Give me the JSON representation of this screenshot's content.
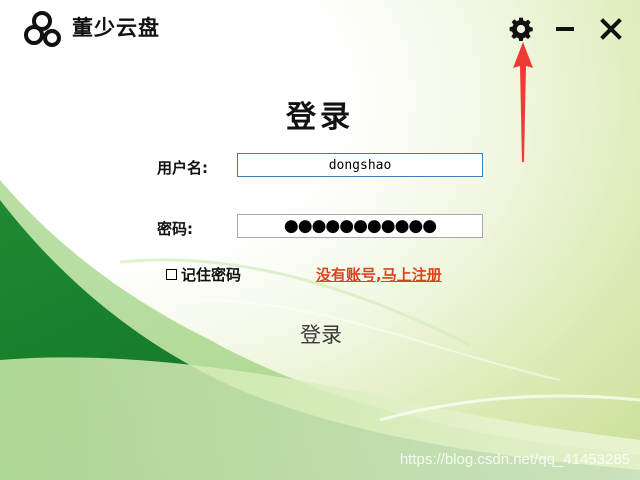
{
  "app": {
    "title": "董少云盘",
    "logo_icon": "cloud-logo-icon"
  },
  "window_controls": {
    "settings_icon": "gear-icon",
    "minimize_icon": "minimize-icon",
    "close_icon": "close-icon"
  },
  "form": {
    "heading": "登录",
    "username_label": "用户名:",
    "username_value": "dongshao",
    "password_label": "密码:",
    "password_masked": "●●●●●●●●●●●",
    "remember_label": "记住密码",
    "remember_checked": false,
    "register_link": "没有账号,马上注册",
    "login_button": "登录"
  },
  "watermark": "https://blog.csdn.net/qq_41453285",
  "colors": {
    "accent_link": "#d9441c",
    "arrow": "#ef3b36",
    "input_border": "#3c7fb1",
    "brand_green": "#2e9a3a"
  }
}
